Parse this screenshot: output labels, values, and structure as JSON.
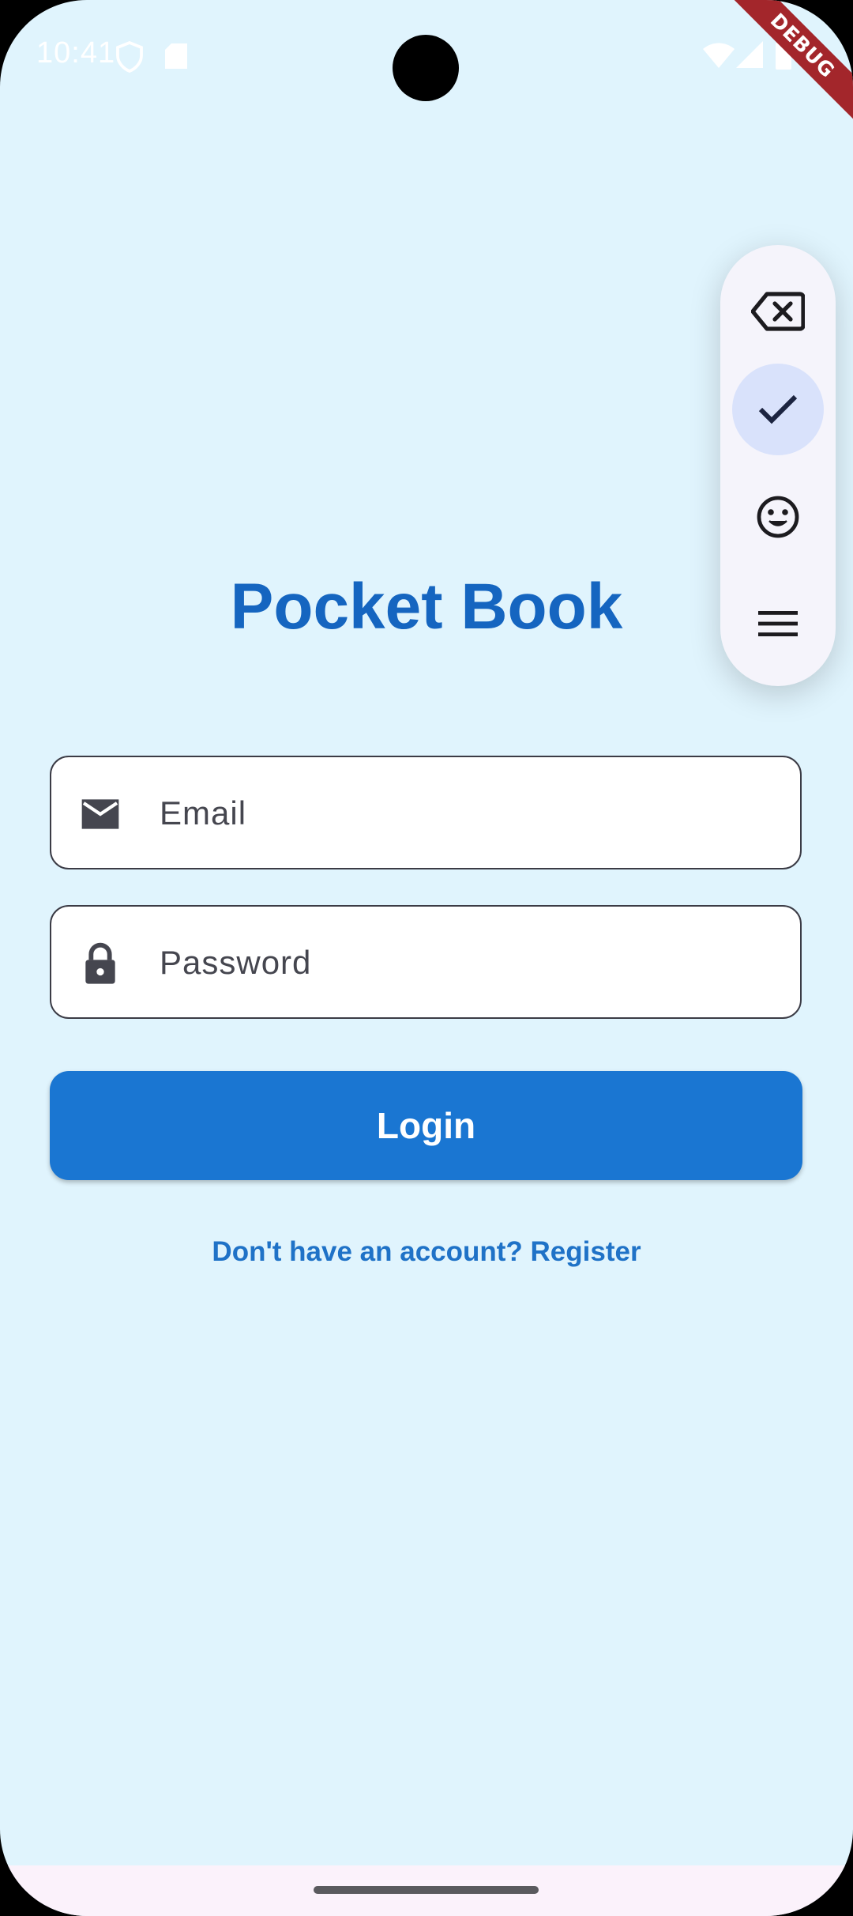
{
  "status_bar": {
    "time": "10:41"
  },
  "debug_banner": "DEBUG",
  "floating_toolbar": {
    "items": [
      {
        "icon": "backspace-icon",
        "active": false
      },
      {
        "icon": "check-icon",
        "active": true
      },
      {
        "icon": "smiley-icon",
        "active": false
      },
      {
        "icon": "menu-icon",
        "active": false
      }
    ]
  },
  "app": {
    "title": "Pocket Book",
    "email": {
      "placeholder": "Email",
      "value": "",
      "icon": "mail-icon"
    },
    "password": {
      "placeholder": "Password",
      "value": "",
      "icon": "lock-icon"
    },
    "login_label": "Login",
    "register_link": "Don't have an account? Register"
  },
  "colors": {
    "background": "#e0f4fd",
    "primary": "#1a76d2",
    "title": "#1565c0"
  }
}
